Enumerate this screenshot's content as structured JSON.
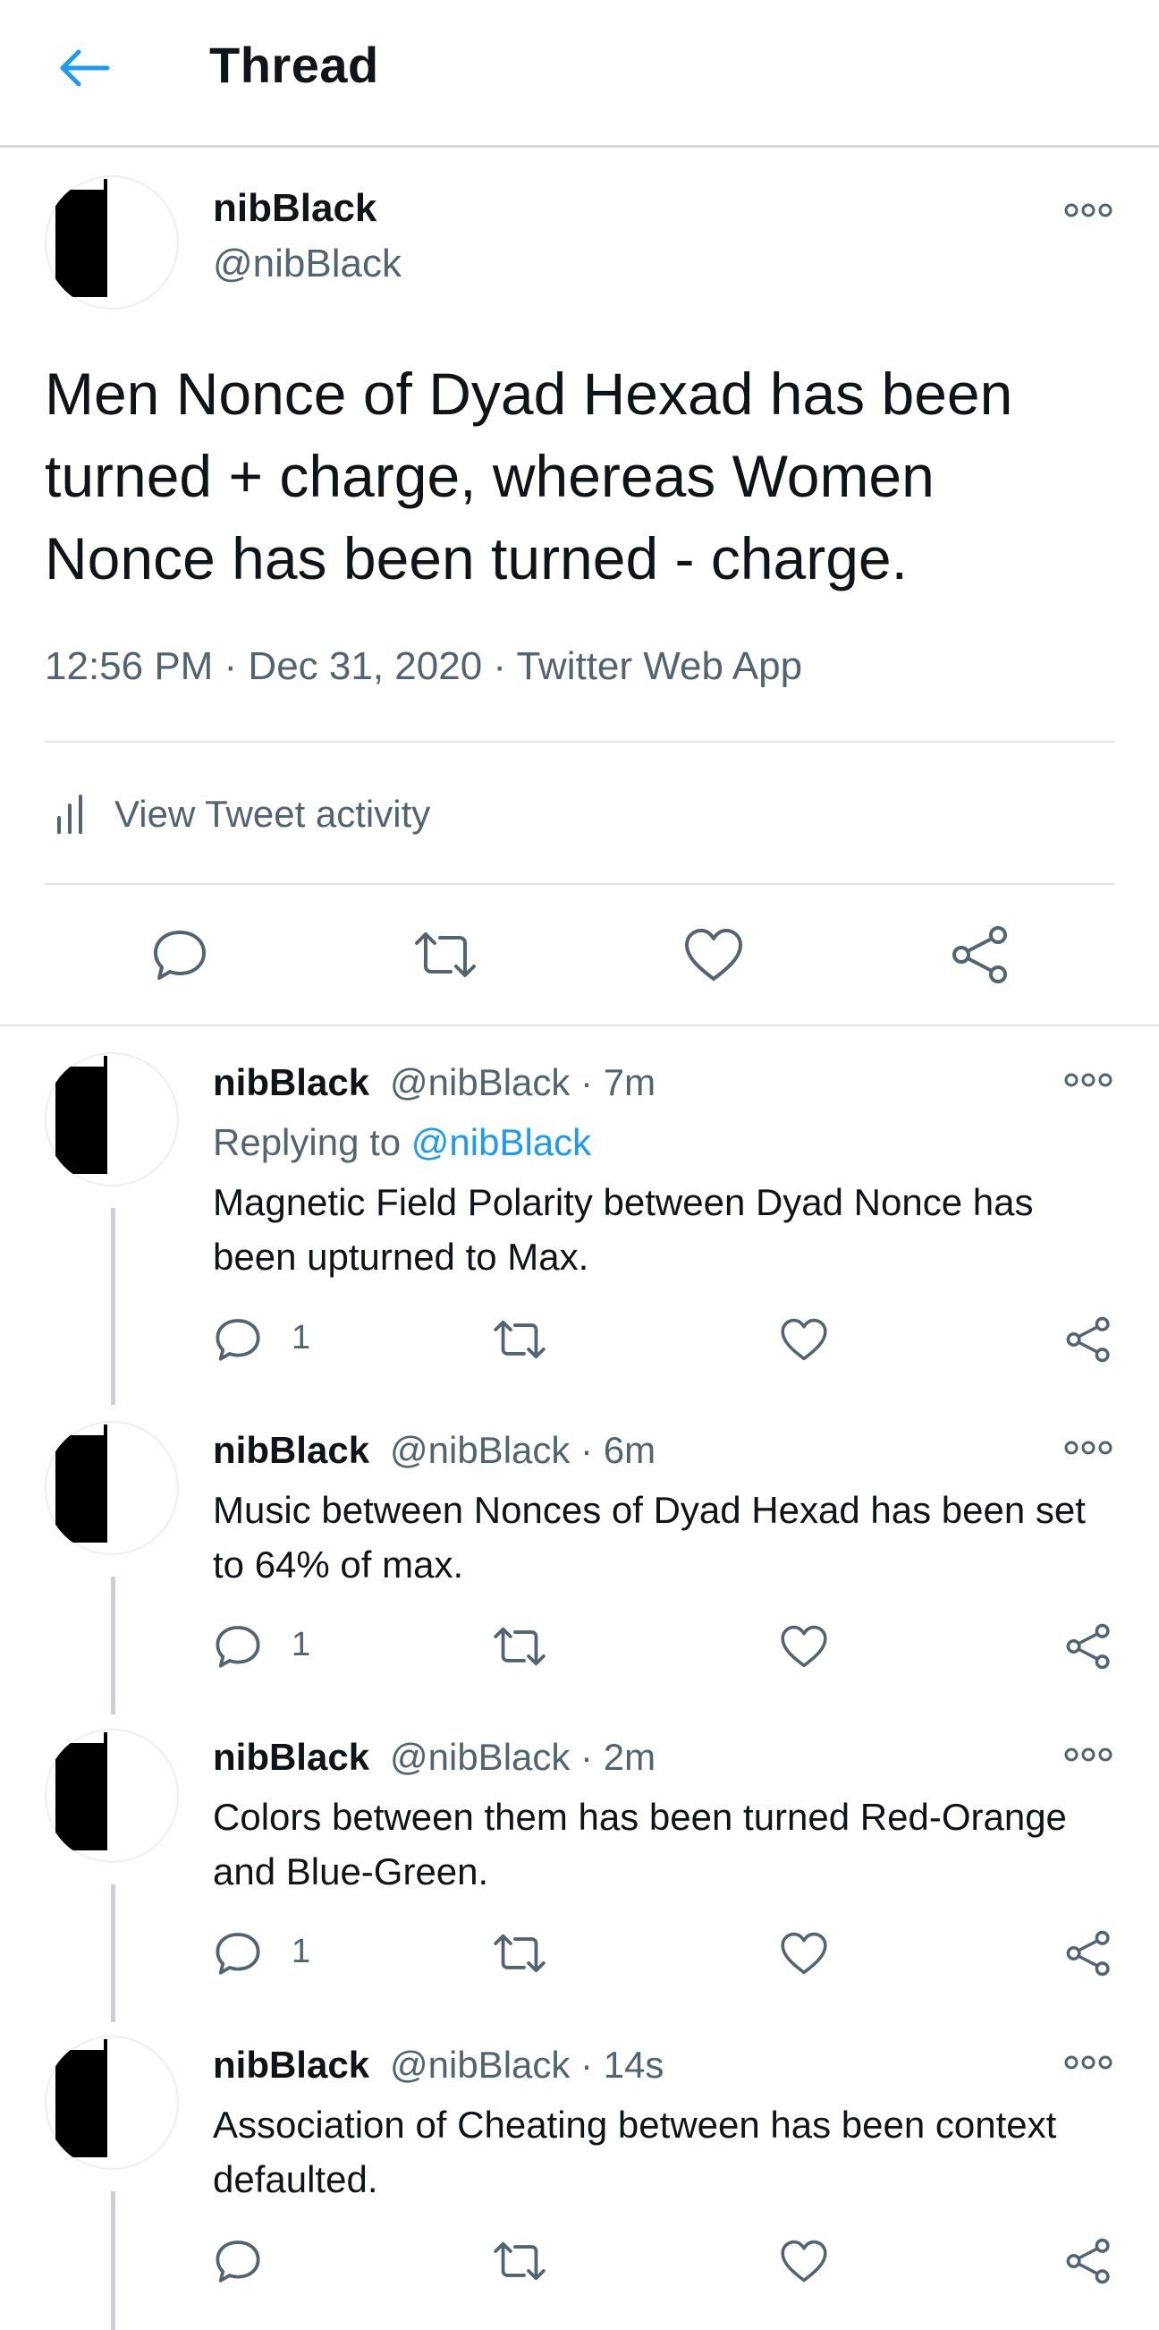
{
  "header": {
    "title": "Thread",
    "back_icon": "arrow-left-icon"
  },
  "colors": {
    "accent": "#1d9bf0",
    "text": "#0f1419",
    "muted": "#536471"
  },
  "main_tweet": {
    "name": "nibBlack",
    "handle": "@nibBlack",
    "text": "Men Nonce of Dyad Hexad has been turned + charge, whereas Women Nonce has been turned - charge.",
    "meta": "12:56 PM · Dec 31, 2020 · Twitter Web App",
    "activity_label": "View Tweet activity"
  },
  "replies": [
    {
      "name": "nibBlack",
      "handle": "@nibBlack · 7m",
      "replying_prefix": "Replying to",
      "replying_to": "@nibBlack",
      "text": "Magnetic Field Polarity between Dyad Nonce has been upturned to Max.",
      "reply_count": "1"
    },
    {
      "name": "nibBlack",
      "handle": "@nibBlack · 6m",
      "text": "Music between Nonces of Dyad Hexad has been set to 64% of max.",
      "reply_count": "1"
    },
    {
      "name": "nibBlack",
      "handle": "@nibBlack · 2m",
      "text": "Colors between them has been turned Red-Orange and Blue-Green.",
      "reply_count": "1"
    },
    {
      "name": "nibBlack",
      "handle": "@nibBlack · 14s",
      "text": "Association of Cheating between has been context defaulted.",
      "reply_count": ""
    }
  ]
}
